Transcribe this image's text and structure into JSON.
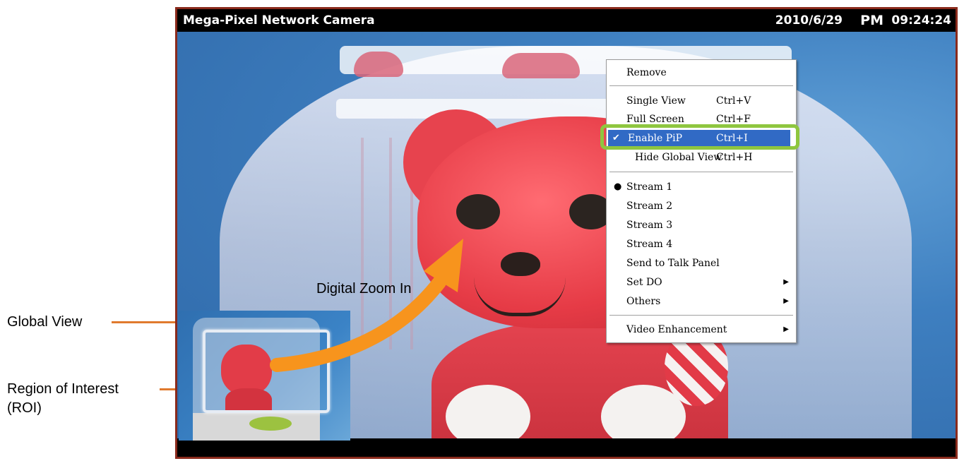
{
  "camera": {
    "title": "Mega-Pixel Network Camera",
    "date": "2010/6/29",
    "ampm": "PM",
    "time": "09:24:24"
  },
  "callouts": {
    "global_view": "Global View",
    "roi_line1": "Region of Interest",
    "roi_line2": "(ROI)",
    "digital_zoom": "Digital Zoom In"
  },
  "colors": {
    "callout_line": "#e07a2e",
    "arrow": "#f7941d",
    "menu_highlight": "#316ac5",
    "highlight_ring": "#8ec63f",
    "window_border": "#8a2a1c"
  },
  "context_menu": {
    "remove": "Remove",
    "single_view": {
      "label": "Single View",
      "shortcut": "Ctrl+V"
    },
    "full_screen": {
      "label": "Full Screen",
      "shortcut": "Ctrl+F"
    },
    "enable_pip": {
      "label": "Enable PiP",
      "shortcut": "Ctrl+I",
      "checked": true
    },
    "hide_global_view": {
      "label": "Hide Global View",
      "shortcut": "Ctrl+H"
    },
    "stream1": "Stream 1",
    "stream2": "Stream 2",
    "stream3": "Stream 3",
    "stream4": "Stream 4",
    "send_to_talk": "Send to Talk Panel",
    "set_do": "Set DO",
    "others": "Others",
    "video_enhancement": "Video Enhancement",
    "selected_stream": "Stream 1"
  }
}
